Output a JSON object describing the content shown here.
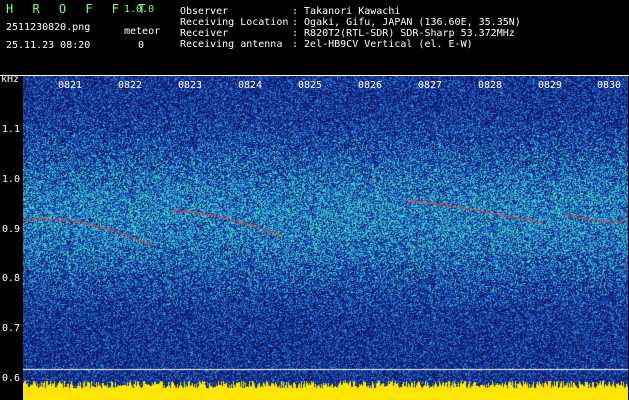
{
  "header": {
    "logo": "H R O F F T",
    "version": "1.0.0",
    "filename": "2511230820.png",
    "datetime": "25.11.23 08:20",
    "meteor_label": "meteor",
    "meteor_count": "0"
  },
  "info": {
    "observer_label": "Observer",
    "observer_value": ": Takanori Kawachi",
    "location_label": "Receiving Location",
    "location_value": ": Ogaki, Gifu, JAPAN (136.60E, 35.35N)",
    "receiver_label": "Receiver",
    "receiver_value": ": R820T2(RTL-SDR) SDR-Sharp 53.372MHz",
    "antenna_label": "Receiving antenna",
    "antenna_value": ": 2el-HB9CV Vertical (el. E-W)"
  },
  "axis": {
    "unit": "kHz",
    "y_ticks": [
      "1.1",
      "1.0",
      "0.9",
      "0.8",
      "0.7",
      "0.6"
    ],
    "x_ticks": [
      "0821",
      "0822",
      "0823",
      "0824",
      "0825",
      "0826",
      "0827",
      "0828",
      "0829",
      "0830"
    ]
  },
  "colors": {
    "background": "#000000",
    "noise_dark": "#101a6a",
    "noise_mid": "#1f4fb8",
    "noise_light": "#35c0c8",
    "signal_red": "#ff3030",
    "baseline_yellow": "#ffe600"
  }
}
